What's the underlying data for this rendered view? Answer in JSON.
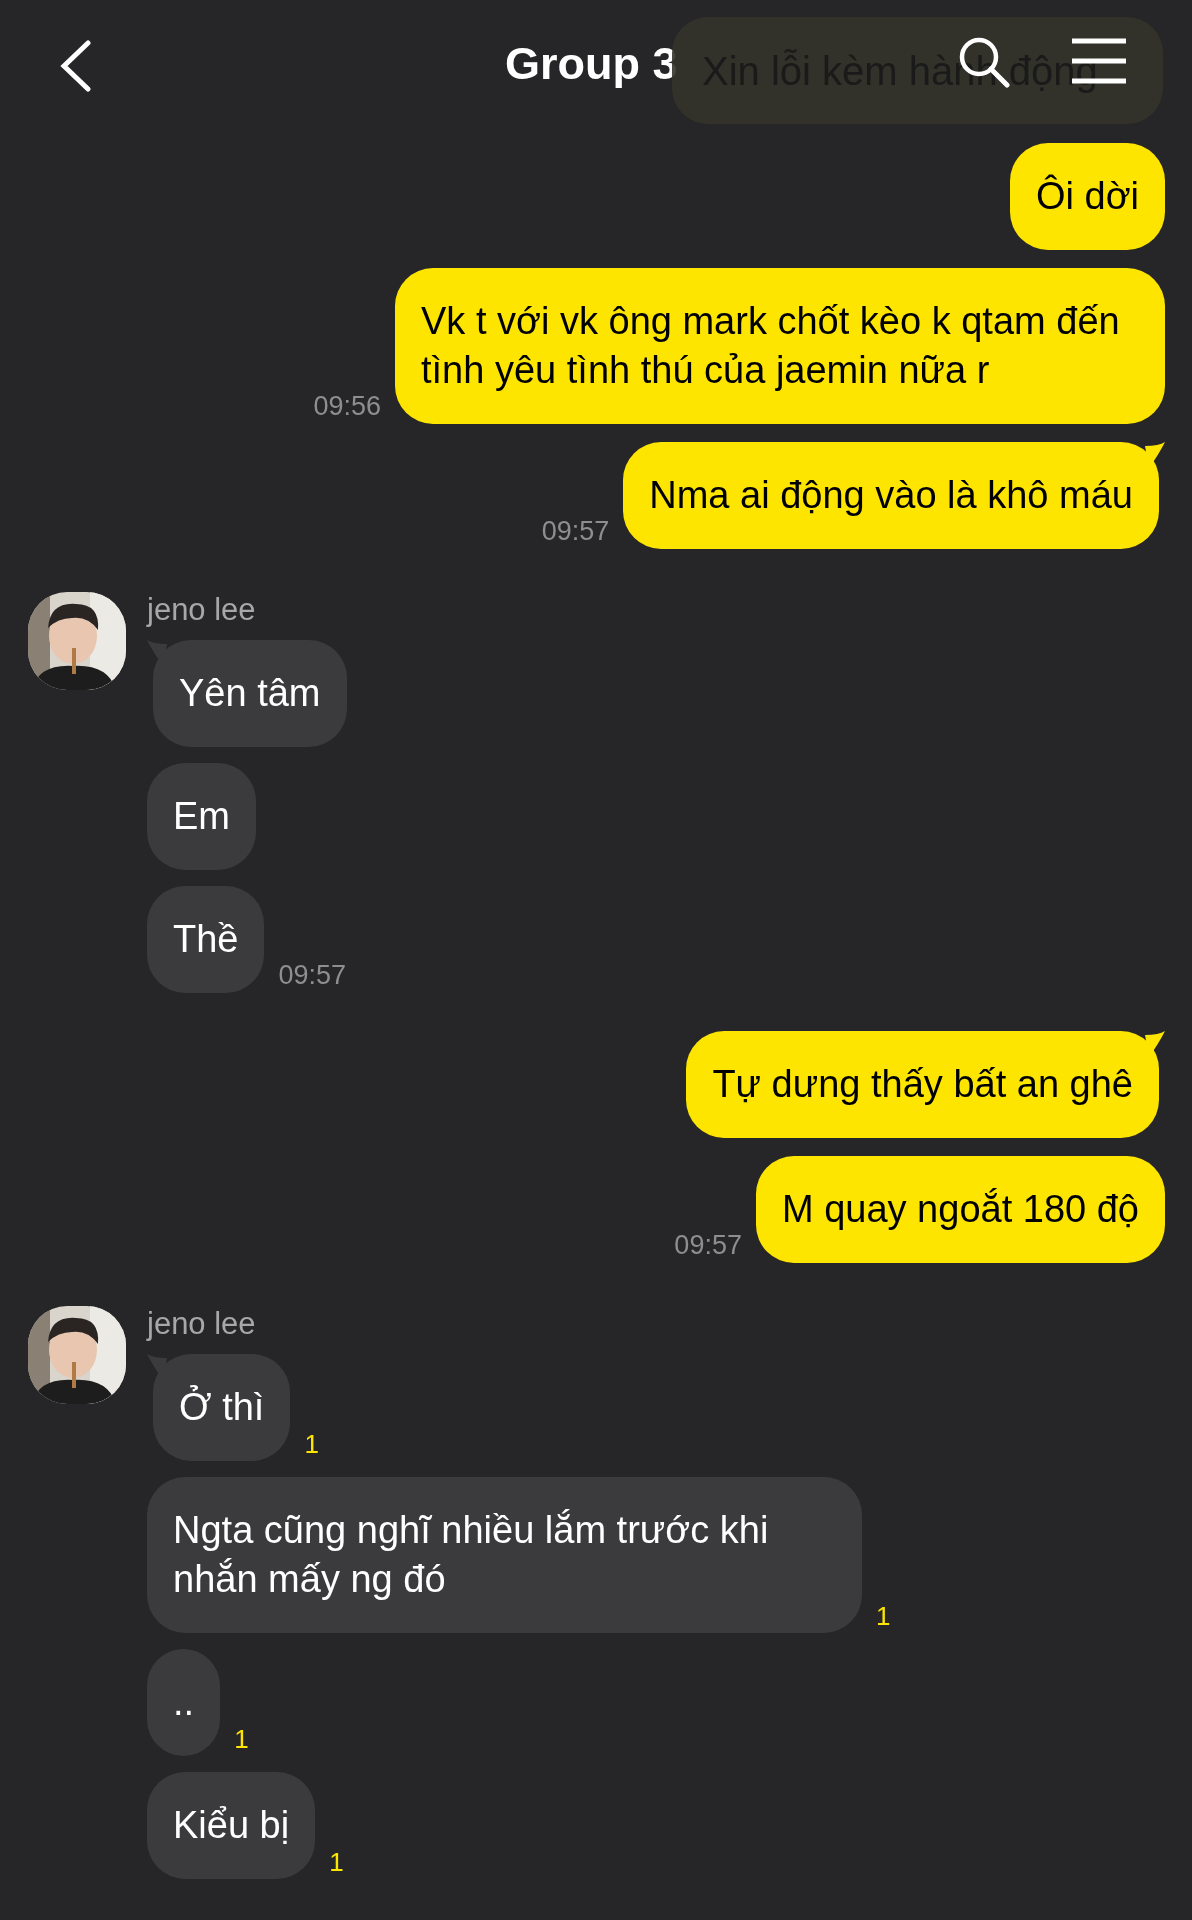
{
  "header": {
    "title": "Group 3",
    "toast": "Xin lỗi kèm hành động"
  },
  "groups": [
    {
      "kind": "me",
      "messages": [
        {
          "text": "Ôi dời",
          "tail": false
        },
        {
          "text": "Vk t với vk ông mark chốt kèo k qtam đến tình yêu tình thú của jaemin nữa r",
          "tail": false,
          "time": "09:56"
        },
        {
          "text": "Nma ai động vào là khô máu",
          "tail": true,
          "time": "09:57"
        }
      ]
    },
    {
      "kind": "other",
      "name": "jeno lee",
      "messages": [
        {
          "text": "Yên tâm",
          "tail": true
        },
        {
          "text": "Em",
          "tail": false
        },
        {
          "text": "Thề",
          "tail": false,
          "time": "09:57"
        }
      ]
    },
    {
      "kind": "me",
      "messages": [
        {
          "text": "Tự dưng thấy bất an ghê",
          "tail": true
        },
        {
          "text": "M quay ngoắt 180 độ",
          "tail": false,
          "time": "09:57"
        }
      ]
    },
    {
      "kind": "other",
      "name": "jeno lee",
      "messages": [
        {
          "text": "Ở thì",
          "tail": true,
          "unread": "1"
        },
        {
          "text": "Ngta cũng nghĩ nhiều lắm trước khi nhắn mấy ng đó",
          "tail": false,
          "unread": "1"
        },
        {
          "text": "..",
          "tail": false,
          "unread": "1"
        },
        {
          "text": "Kiểu bị",
          "tail": false,
          "unread": "1"
        }
      ]
    }
  ]
}
